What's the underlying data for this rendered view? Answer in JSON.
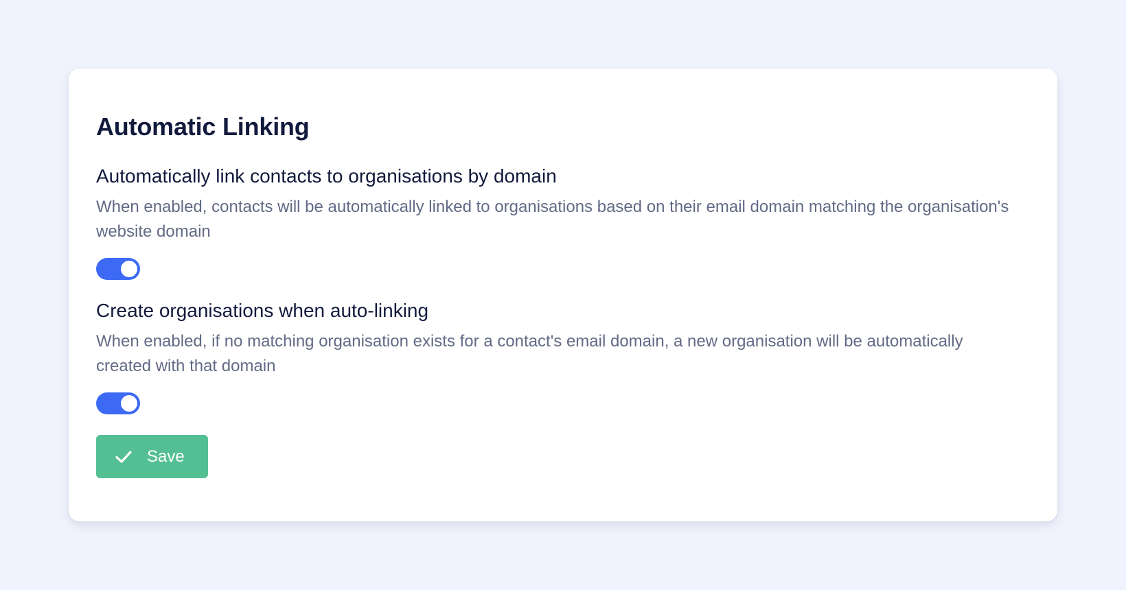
{
  "settings_card": {
    "title": "Automatic Linking",
    "settings": [
      {
        "label": "Automatically link contacts to organisations by domain",
        "description": "When enabled, contacts will be automatically linked to organisations based on their email domain matching the organisation's website domain",
        "enabled": true
      },
      {
        "label": "Create organisations when auto-linking",
        "description": "When enabled, if no matching organisation exists for a contact's email domain, a new organisation will be automatically created with that domain",
        "enabled": true
      }
    ],
    "save_button": {
      "label": "Save",
      "icon": "check-icon"
    }
  },
  "colors": {
    "page_background": "#f0f3fd",
    "card_background": "#ffffff",
    "heading_text": "#121a3c",
    "description_text": "#626a85",
    "toggle_on": "#3d6af5",
    "save_button": "#54bf93"
  }
}
